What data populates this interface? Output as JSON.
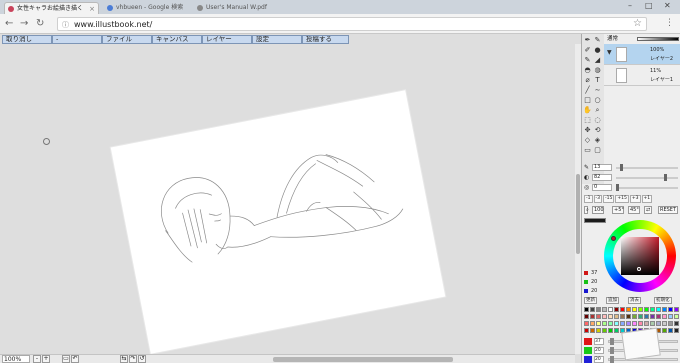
{
  "browser": {
    "tabs": [
      {
        "label": "女性キャラお絵描き描く",
        "active": true
      },
      {
        "label": "vhbueen - Google 検索",
        "active": false
      },
      {
        "label": "User's Manual W.pdf",
        "active": false
      }
    ],
    "url": "www.illustbook.net/"
  },
  "menu": [
    "取り消し",
    "-",
    "ファイル",
    "キャンバス",
    "レイヤー",
    "設定",
    "投稿する"
  ],
  "layers": {
    "blend_mode": "通常",
    "items": [
      {
        "opacity": "100%",
        "name": "レイヤー2",
        "active": true
      },
      {
        "opacity": "11%",
        "name": "レイヤー1",
        "active": false
      }
    ]
  },
  "brush": {
    "size": "13",
    "density": "82",
    "blur": "0",
    "size_steps": [
      "-1",
      "-3",
      "-15",
      "+15",
      "+3",
      "+1"
    ],
    "zoom": "100",
    "rotate_left": "+5°",
    "rotate_value": "45°",
    "reset": "RESET"
  },
  "color": {
    "r": "37",
    "g": "20",
    "b": "20",
    "accent": "#c41b2a",
    "swatch_tabs": [
      "更新",
      "追加",
      "消去",
      "初期化"
    ],
    "slider_values": [
      "37",
      "20",
      "20"
    ]
  },
  "status": {
    "zoom": "100%"
  }
}
